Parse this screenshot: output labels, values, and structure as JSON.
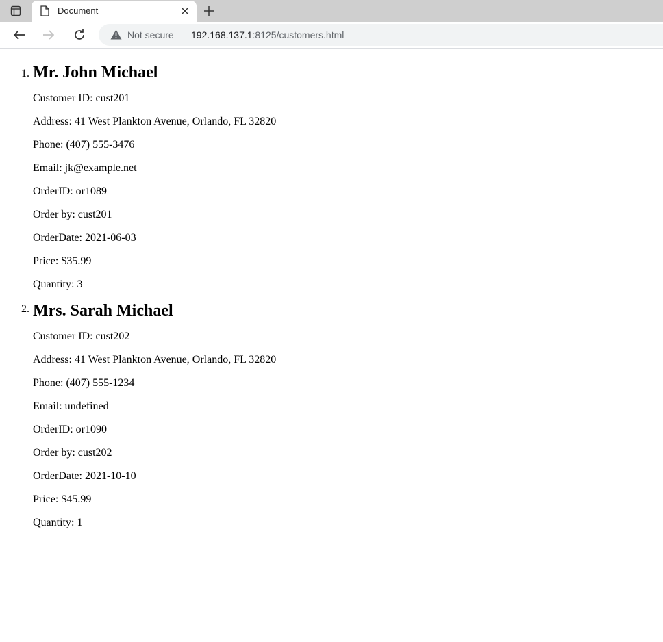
{
  "browser": {
    "tab_title": "Document",
    "security_label": "Not secure",
    "url_host": "192.168.137.1",
    "url_rest": ":8125/customers.html"
  },
  "customers": [
    {
      "number": "1.",
      "name": "Mr. John Michael",
      "fields": [
        "Customer ID: cust201",
        "Address: 41 West Plankton Avenue, Orlando, FL 32820",
        "Phone: (407) 555-3476",
        "Email: jk@example.net",
        "OrderID: or1089",
        "Order by: cust201",
        "OrderDate: 2021-06-03",
        "Price: $35.99",
        "Quantity: 3"
      ]
    },
    {
      "number": "2.",
      "name": "Mrs. Sarah Michael",
      "fields": [
        "Customer ID: cust202",
        "Address: 41 West Plankton Avenue, Orlando, FL 32820",
        "Phone: (407) 555-1234",
        "Email: undefined",
        "OrderID: or1090",
        "Order by: cust202",
        "OrderDate: 2021-10-10",
        "Price: $45.99",
        "Quantity: 1"
      ]
    }
  ]
}
